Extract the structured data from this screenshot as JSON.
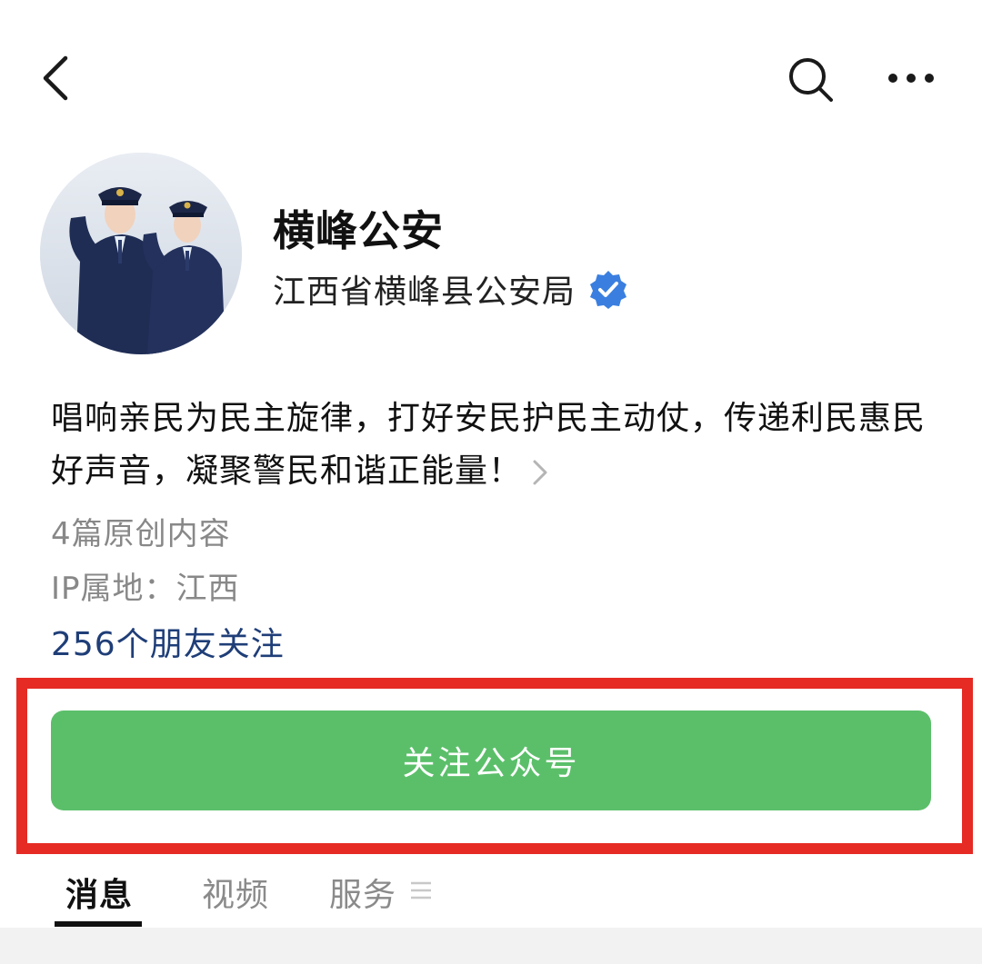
{
  "header": {
    "back_icon": "chevron-left-icon",
    "search_icon": "search-icon",
    "more_icon": "more-horizontal-icon"
  },
  "profile": {
    "avatar": "avatar-two-police-officers-saluting",
    "name": "横峰公安",
    "organization": "江西省横峰县公安局",
    "verified_icon": "verified-badge-icon",
    "verified_color": "#3a7fe0",
    "description": "唱响亲民为民主旋律，打好安民护民主动仗，传递利民惠民好声音，凝聚警民和谐正能量！",
    "original_articles": "4篇原创内容",
    "ip_location": "IP属地：江西",
    "friends_following": "256个朋友关注"
  },
  "follow_button": {
    "label": "关注公众号",
    "color": "#5bbf6a",
    "highlight_color": "#e52b24"
  },
  "tabs": [
    {
      "label": "消息",
      "active": true
    },
    {
      "label": "视频",
      "active": false
    },
    {
      "label": "服务",
      "active": false
    }
  ],
  "tabs_menu_icon": "menu-lines-icon"
}
